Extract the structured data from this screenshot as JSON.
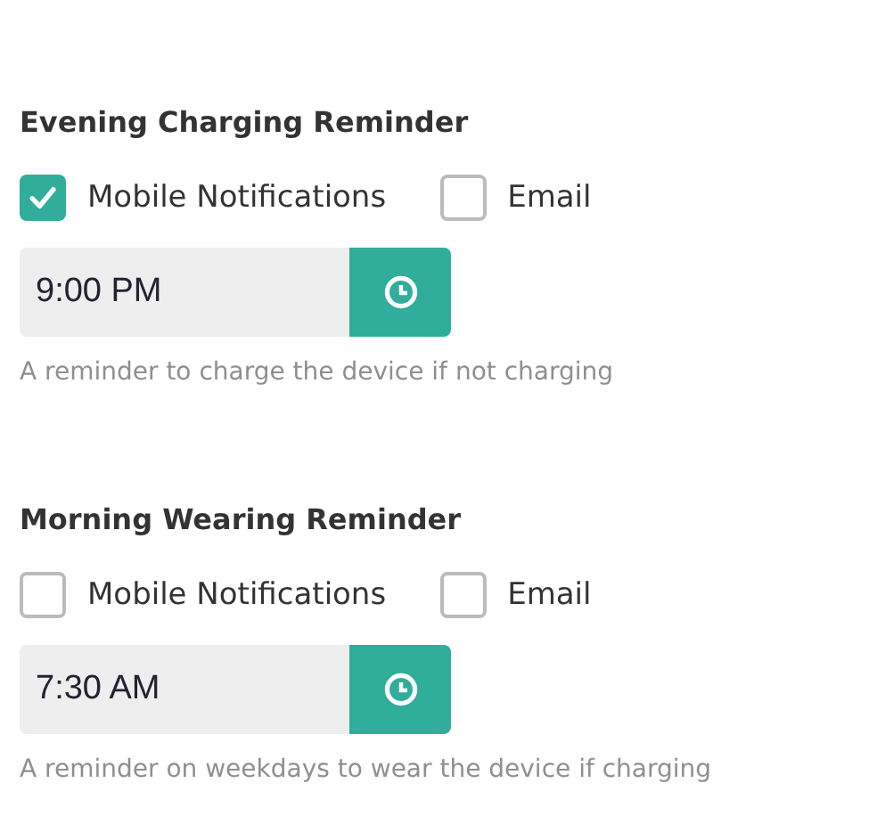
{
  "reminders": [
    {
      "title": "Evening Charging Reminder",
      "options": [
        {
          "label": "Mobile Notifications",
          "checked": true
        },
        {
          "label": "Email",
          "checked": false
        }
      ],
      "time": "9:00 PM",
      "hint": "A reminder to charge the device if not charging"
    },
    {
      "title": "Morning Wearing Reminder",
      "options": [
        {
          "label": "Mobile Notifications",
          "checked": false
        },
        {
          "label": "Email",
          "checked": false
        }
      ],
      "time": "7:30 AM",
      "hint": "A reminder on weekdays to wear the device if charging"
    }
  ]
}
